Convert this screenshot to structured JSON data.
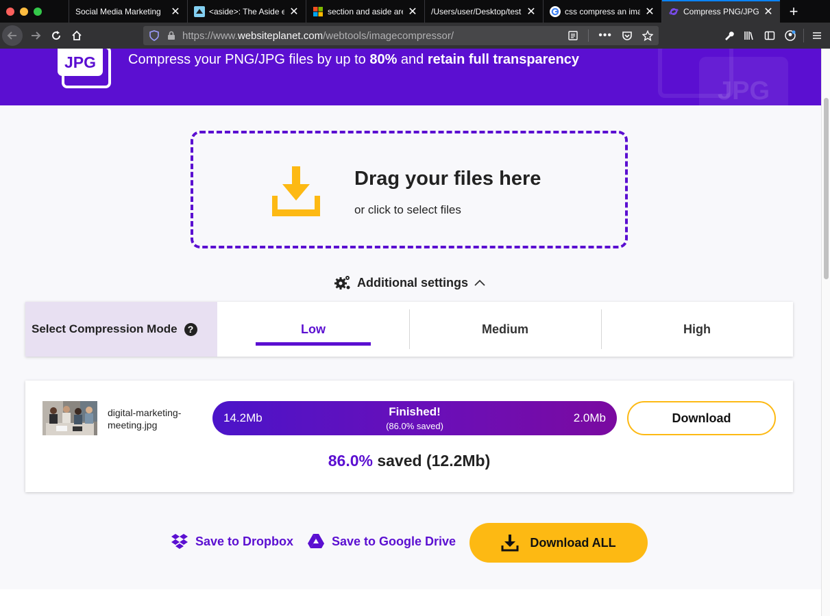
{
  "browser": {
    "tabs": [
      {
        "title": "Social Media Marketing",
        "favicon": "none"
      },
      {
        "title": "<aside>: The Aside el",
        "favicon": "mdn-icon"
      },
      {
        "title": "section and aside are",
        "favicon": "microsoft-icon"
      },
      {
        "title": "/Users/user/Desktop/test",
        "favicon": "none"
      },
      {
        "title": "css compress an imag",
        "favicon": "google-icon"
      },
      {
        "title": "Compress PNG/JPG F",
        "favicon": "websiteplanet-icon",
        "active": true
      }
    ],
    "url_prefix": "https://www.",
    "url_domain": "websiteplanet.com",
    "url_path": "/webtools/imagecompressor/",
    "accent": "#0a84ff"
  },
  "hero": {
    "logo_text": "JPG",
    "deco_text": "JPG",
    "tagline_start": "Compress your PNG/JPG files by up to ",
    "tagline_pct": "80%",
    "tagline_mid": " and ",
    "tagline_end": "retain full transparency",
    "color": "#5b0fd1"
  },
  "dropzone": {
    "title": "Drag your files here",
    "subtitle": "or click to select files",
    "icon": "download-tray-icon",
    "icon_color": "#fdb913"
  },
  "settings": {
    "label": "Additional settings",
    "icon": "gears-icon",
    "expanded": true
  },
  "compression": {
    "label": "Select Compression Mode",
    "help": "?",
    "options": [
      "Low",
      "Medium",
      "High"
    ],
    "selected": "Low"
  },
  "result": {
    "filename_line1": "digital-marketing-",
    "filename_line2": "meeting.jpg",
    "original_size": "14.2Mb",
    "new_size": "2.0Mb",
    "status": "Finished!",
    "saved_note": "(86.0% saved)",
    "download_label": "Download",
    "summary_pct": "86.0%",
    "summary_rest": " saved (12.2Mb)"
  },
  "actions": {
    "dropbox_label": "Save to Dropbox",
    "gdrive_label": "Save to Google Drive",
    "download_all_label": "Download ALL",
    "brand_yellow": "#fdb913"
  }
}
